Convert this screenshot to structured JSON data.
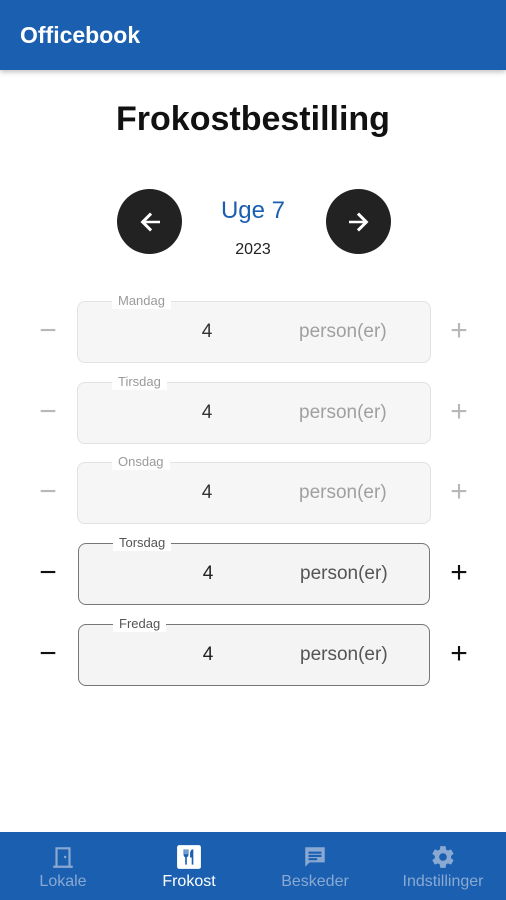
{
  "app": {
    "title": "Officebook"
  },
  "page": {
    "title": "Frokostbestilling"
  },
  "week": {
    "label": "Uge 7",
    "year": "2023"
  },
  "days": [
    {
      "name": "Mandag",
      "value": "4",
      "unit": "person(er)",
      "enabled": false
    },
    {
      "name": "Tirsdag",
      "value": "4",
      "unit": "person(er)",
      "enabled": false
    },
    {
      "name": "Onsdag",
      "value": "4",
      "unit": "person(er)",
      "enabled": false
    },
    {
      "name": "Torsdag",
      "value": "4",
      "unit": "person(er)",
      "enabled": true
    },
    {
      "name": "Fredag",
      "value": "4",
      "unit": "person(er)",
      "enabled": true
    }
  ],
  "stepper": {
    "minus": "−",
    "plus": "+"
  },
  "nav": [
    {
      "label": "Lokale",
      "icon": "door-icon",
      "selected": false
    },
    {
      "label": "Frokost",
      "icon": "cutlery-icon",
      "selected": true
    },
    {
      "label": "Beskeder",
      "icon": "message-icon",
      "selected": false
    },
    {
      "label": "Indstillinger",
      "icon": "gear-icon",
      "selected": false
    }
  ],
  "colors": {
    "primary": "#1a5fb0",
    "nav_inactive": "#8aa9d2"
  }
}
